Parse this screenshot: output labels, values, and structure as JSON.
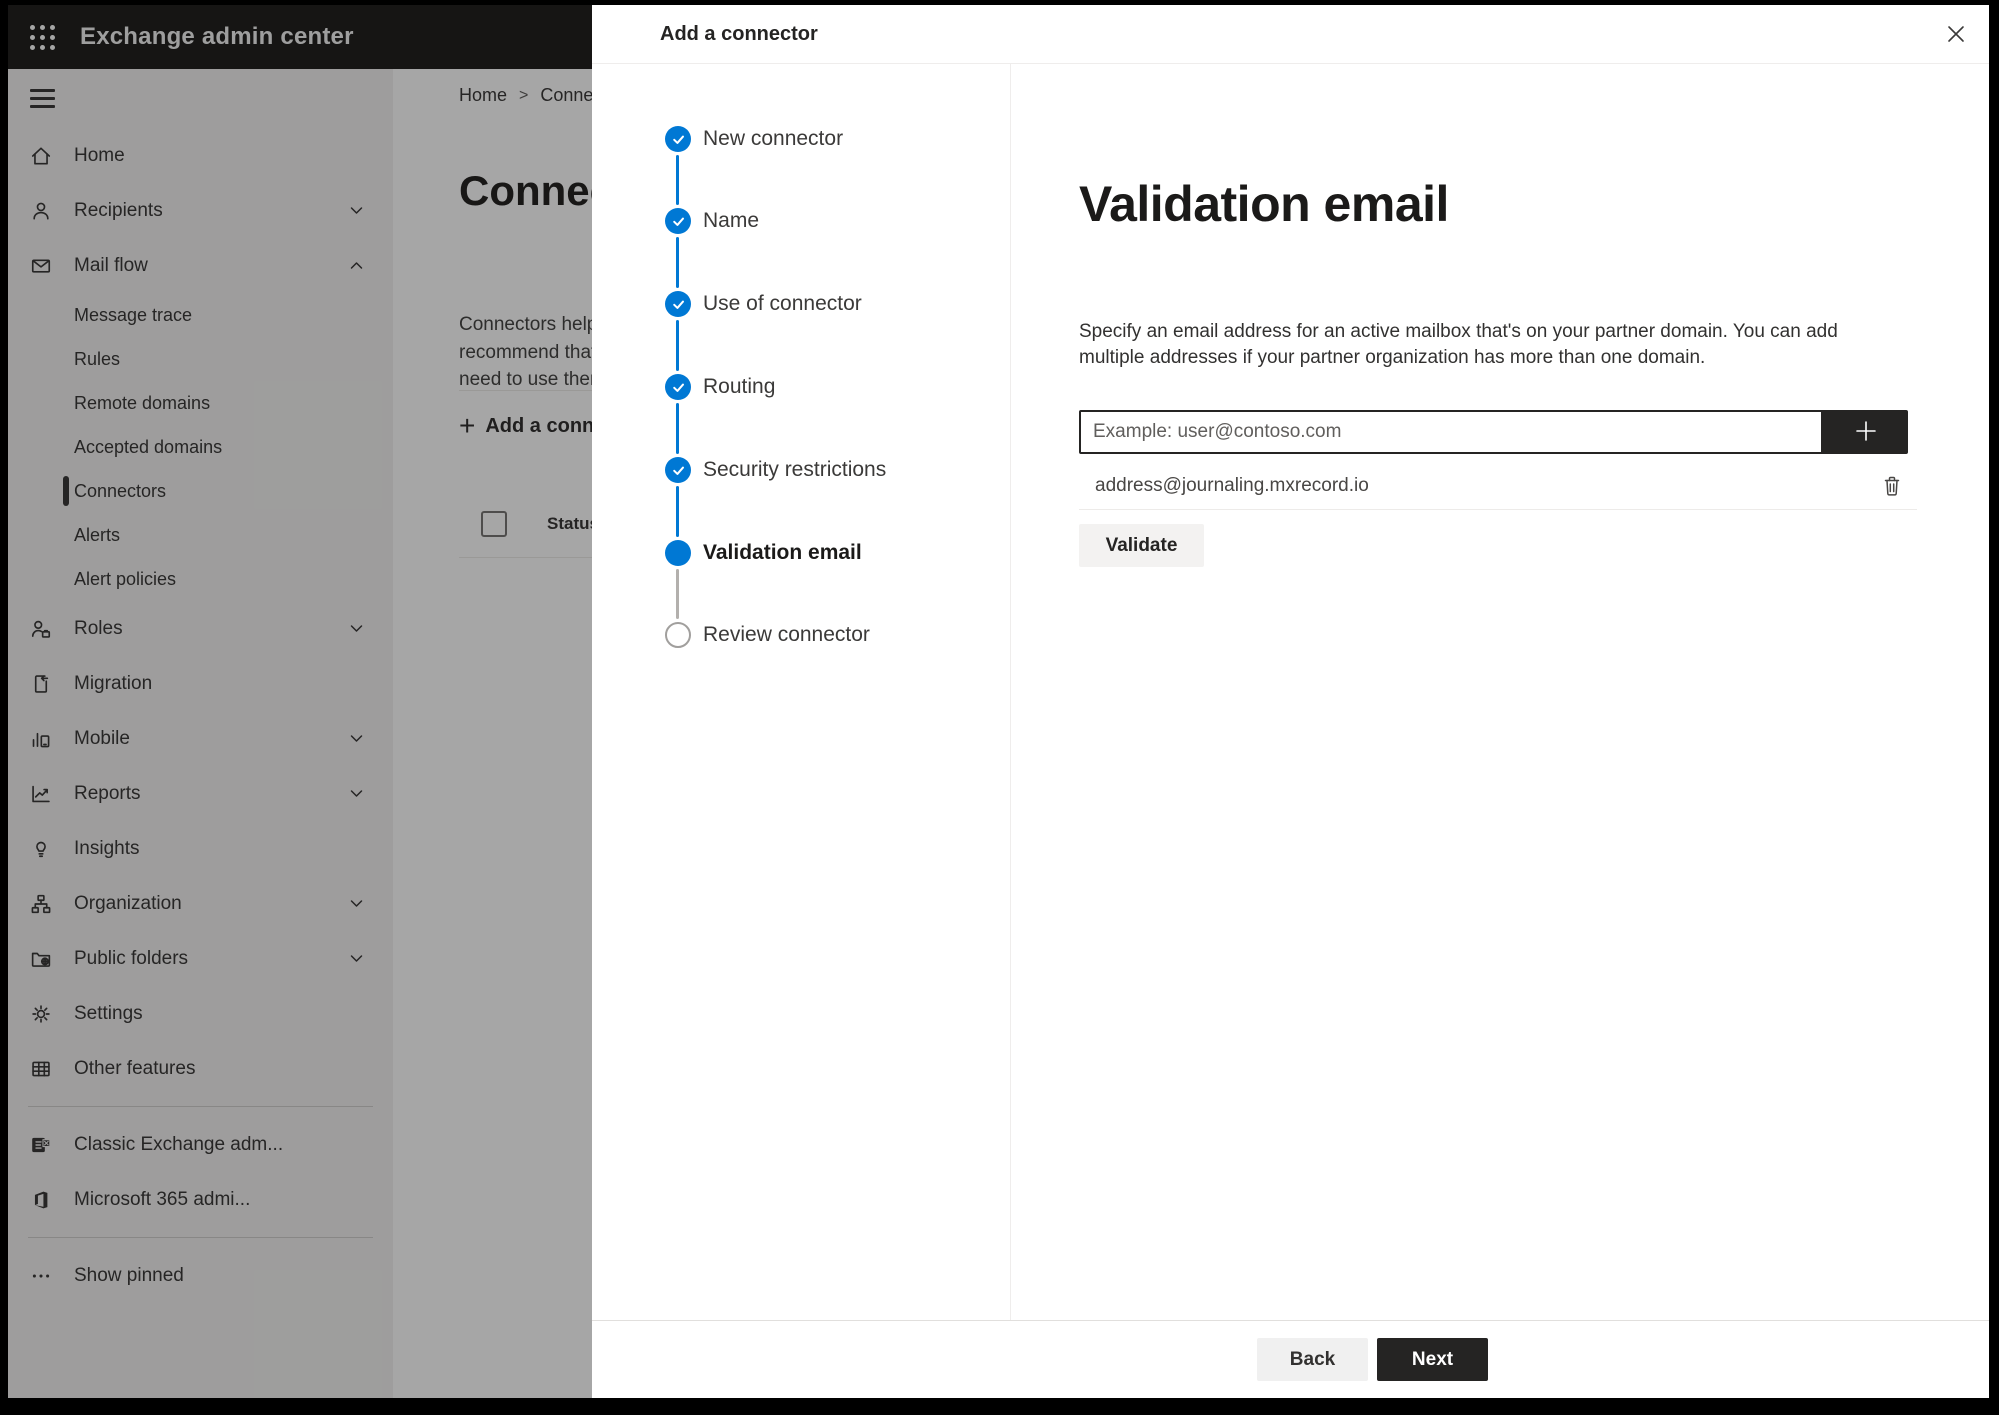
{
  "window": {
    "app_title": "Exchange admin center"
  },
  "colors": {
    "accent": "#0078d4",
    "primary_button": "#252423",
    "topbar": "#222120",
    "sidebar_bg": "#f3f2f1"
  },
  "icons": {
    "app_launcher": "waffle-grid",
    "menu": "hamburger",
    "close": "x",
    "add_address": "plus",
    "remove_address": "trash",
    "step_done": "check"
  },
  "sidebar": {
    "items": [
      {
        "label": "Home",
        "icon": "home"
      },
      {
        "label": "Recipients",
        "icon": "recipients",
        "chevron": "down"
      },
      {
        "label": "Mail flow",
        "icon": "mail-flow",
        "chevron": "up"
      },
      {
        "label": "Message trace",
        "sub": true
      },
      {
        "label": "Rules",
        "sub": true
      },
      {
        "label": "Remote domains",
        "sub": true
      },
      {
        "label": "Accepted domains",
        "sub": true
      },
      {
        "label": "Connectors",
        "sub": true,
        "selected": true
      },
      {
        "label": "Alerts",
        "sub": true
      },
      {
        "label": "Alert policies",
        "sub": true
      },
      {
        "label": "Roles",
        "icon": "roles",
        "chevron": "down"
      },
      {
        "label": "Migration",
        "icon": "migration"
      },
      {
        "label": "Mobile",
        "icon": "mobile",
        "chevron": "down"
      },
      {
        "label": "Reports",
        "icon": "reports",
        "chevron": "down"
      },
      {
        "label": "Insights",
        "icon": "insights"
      },
      {
        "label": "Organization",
        "icon": "organization",
        "chevron": "down"
      },
      {
        "label": "Public folders",
        "icon": "public-folders",
        "chevron": "down"
      },
      {
        "label": "Settings",
        "icon": "settings"
      },
      {
        "label": "Other features",
        "icon": "other-features"
      },
      {
        "divider": true
      },
      {
        "label": "Classic Exchange adm...",
        "icon": "classic-exchange"
      },
      {
        "label": "Microsoft 365 admi...",
        "icon": "microsoft-365"
      },
      {
        "divider": true
      },
      {
        "label": "Show pinned",
        "icon": "more"
      }
    ]
  },
  "background_page": {
    "breadcrumb": {
      "home": "Home",
      "separator": ">",
      "current_fragment": "Conne"
    },
    "title_fragment": "Connec",
    "paragraph_lines": [
      "Connectors help",
      "recommend that",
      "need to use ther"
    ],
    "add_button_label": "Add a conn",
    "table": {
      "status_header": "Status"
    }
  },
  "dialog": {
    "title": "Add a connector",
    "steps": [
      {
        "label": "New connector",
        "state": "completed"
      },
      {
        "label": "Name",
        "state": "completed"
      },
      {
        "label": "Use of connector",
        "state": "completed"
      },
      {
        "label": "Routing",
        "state": "completed"
      },
      {
        "label": "Security restrictions",
        "state": "completed"
      },
      {
        "label": "Validation email",
        "state": "current"
      },
      {
        "label": "Review connector",
        "state": "upcoming"
      }
    ],
    "content": {
      "heading": "Validation email",
      "description_lines": [
        "Specify an email address for an active mailbox that's on your partner domain. You can add",
        "multiple addresses if your partner organization has more than one domain."
      ],
      "input_placeholder": "Example: user@contoso.com",
      "added_address": "address@journaling.mxrecord.io",
      "validate_button": "Validate"
    },
    "footer": {
      "back": "Back",
      "next": "Next"
    }
  }
}
